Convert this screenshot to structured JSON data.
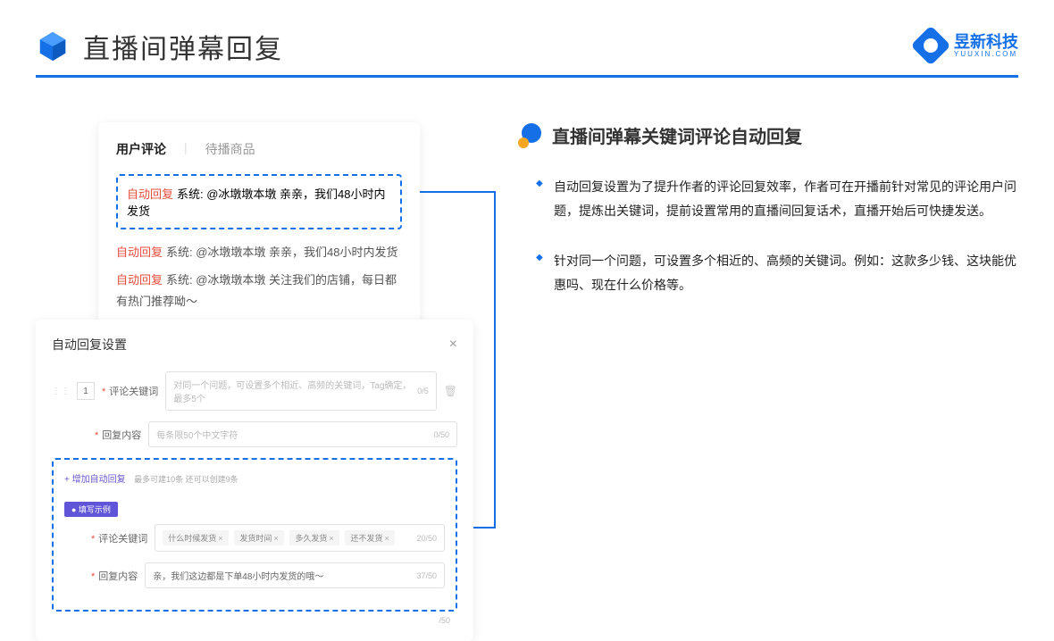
{
  "header": {
    "title": "直播间弹幕回复"
  },
  "brand": {
    "name": "昱新科技",
    "domain": "YUUXIN.COM"
  },
  "card1": {
    "tab_active": "用户评论",
    "tab_inactive": "待播商品",
    "highlighted": {
      "label": "自动回复",
      "text": "系统: @冰墩墩本墩 亲亲，我们48小时内发货"
    },
    "items": [
      {
        "label": "自动回复",
        "text": "系统: @冰墩墩本墩 亲亲，我们48小时内发货"
      },
      {
        "label": "自动回复",
        "text": "系统: @冰墩墩本墩 关注我们的店铺，每日都有热门推荐呦～"
      }
    ]
  },
  "card2": {
    "title": "自动回复设置",
    "close": "×",
    "row_number": "1",
    "keyword_label": "评论关键词",
    "keyword_placeholder": "对同一个问题，可设置多个相近、高频的关键词，Tag确定，最多5个",
    "keyword_count": "0/5",
    "content_label": "回复内容",
    "content_placeholder": "每条限50个中文字符",
    "content_count": "0/50",
    "add_link": "+ 增加自动回复",
    "add_hint": "最多可建10条 还可以创建9条",
    "example_badge": "● 填写示例",
    "ex_keyword_label": "评论关键词",
    "ex_tags": [
      "什么时候发货",
      "发货时间",
      "多久发货",
      "还不发货"
    ],
    "ex_keyword_count": "20/50",
    "ex_content_label": "回复内容",
    "ex_content_text": "亲，我们这边都是下单48小时内发货的哦～",
    "ex_content_count": "37/50",
    "outer_count": "/50"
  },
  "right": {
    "title": "直播间弹幕关键词评论自动回复",
    "bullets": [
      "自动回复设置为了提升作者的评论回复效率，作者可在开播前针对常见的评论用户问题，提炼出关键词，提前设置常用的直播间回复话术，直播开始后可快捷发送。",
      "针对同一个问题，可设置多个相近的、高频的关键词。例如：这款多少钱、这块能优惠吗、现在什么价格等。"
    ]
  }
}
